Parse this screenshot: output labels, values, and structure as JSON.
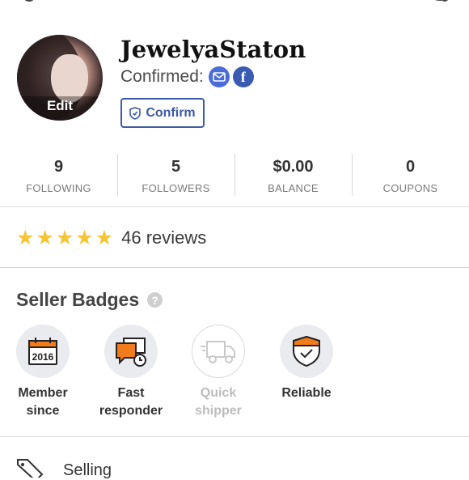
{
  "profile": {
    "username": "JewelyaStaton",
    "confirmed_label": "Confirmed:",
    "avatar_edit_label": "Edit",
    "confirm_button_label": "Confirm"
  },
  "stats": [
    {
      "value": "9",
      "label": "FOLLOWING"
    },
    {
      "value": "5",
      "label": "FOLLOWERS"
    },
    {
      "value": "$0.00",
      "label": "BALANCE"
    },
    {
      "value": "0",
      "label": "COUPONS"
    }
  ],
  "rating": {
    "stars": 5,
    "reviews_text": "46 reviews"
  },
  "seller_badges": {
    "title": "Seller Badges",
    "items": [
      {
        "icon": "calendar-icon",
        "year": "2016",
        "line1": "Member",
        "line2": "since",
        "active": true
      },
      {
        "icon": "chat-clock-icon",
        "line1": "Fast",
        "line2": "responder",
        "active": true
      },
      {
        "icon": "truck-icon",
        "line1": "Quick",
        "line2": "shipper",
        "active": false
      },
      {
        "icon": "shield-check-icon",
        "line1": "Reliable",
        "line2": "",
        "active": true
      }
    ]
  },
  "selling_label": "Selling",
  "colors": {
    "accent_blue": "#3d5aa8",
    "star": "#f7c531",
    "badge_orange": "#f07c1c"
  }
}
